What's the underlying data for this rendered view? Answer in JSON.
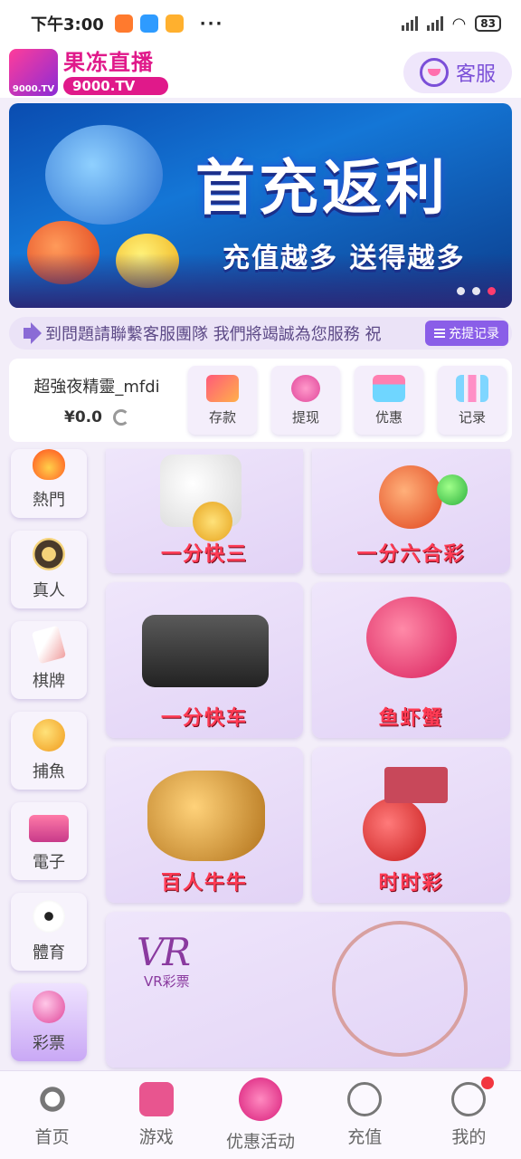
{
  "status_bar": {
    "time": "下午3:00",
    "more": "···",
    "battery": "83"
  },
  "header": {
    "logo_badge": "9000.TV",
    "logo_title": "果冻直播",
    "logo_url": "9000.TV",
    "service_label": "客服"
  },
  "banner": {
    "headline": "首充返利",
    "subline": "充值越多 送得越多",
    "pages": 3,
    "active_page": 3
  },
  "marquee": {
    "text": "到問題請聯繫客服團隊 我們將竭誠為您服務 祝",
    "button_label": "充提记录"
  },
  "account": {
    "username": "超強夜精靈_mfdi",
    "balance": "¥0.0",
    "actions": [
      {
        "label": "存款",
        "icon": "card-icon"
      },
      {
        "label": "提现",
        "icon": "money-bag-icon"
      },
      {
        "label": "优惠",
        "icon": "gift-icon"
      },
      {
        "label": "记录",
        "icon": "bar-chart-icon"
      }
    ]
  },
  "categories": [
    {
      "label": "熱門",
      "icon": "flame-icon"
    },
    {
      "label": "真人",
      "icon": "casino-chip-icon"
    },
    {
      "label": "棋牌",
      "icon": "playing-card-icon"
    },
    {
      "label": "捕魚",
      "icon": "fish-icon"
    },
    {
      "label": "電子",
      "icon": "slot-machine-icon"
    },
    {
      "label": "體育",
      "icon": "soccer-ball-icon"
    },
    {
      "label": "彩票",
      "icon": "lottery-ball-icon"
    }
  ],
  "active_category": "彩票",
  "games": [
    {
      "label": "一分快三"
    },
    {
      "label": "一分六合彩"
    },
    {
      "label": "一分快车"
    },
    {
      "label": "鱼虾蟹"
    },
    {
      "label": "百人牛牛"
    },
    {
      "label": "时时彩"
    },
    {
      "logo": "VR",
      "subtitle": "VR彩票"
    }
  ],
  "bottom_nav": [
    {
      "label": "首页",
      "icon": "home-avatar-icon"
    },
    {
      "label": "游戏",
      "icon": "gamepad-icon"
    },
    {
      "label": "优惠活动",
      "icon": "promo-badge-icon"
    },
    {
      "label": "充值",
      "icon": "recharge-icon"
    },
    {
      "label": "我的",
      "icon": "user-icon"
    }
  ],
  "colors": {
    "brand_pink": "#e0198a",
    "accent_purple": "#8a5ee8",
    "game_label_red": "#ff3b54",
    "notification_red": "#f2363f"
  }
}
